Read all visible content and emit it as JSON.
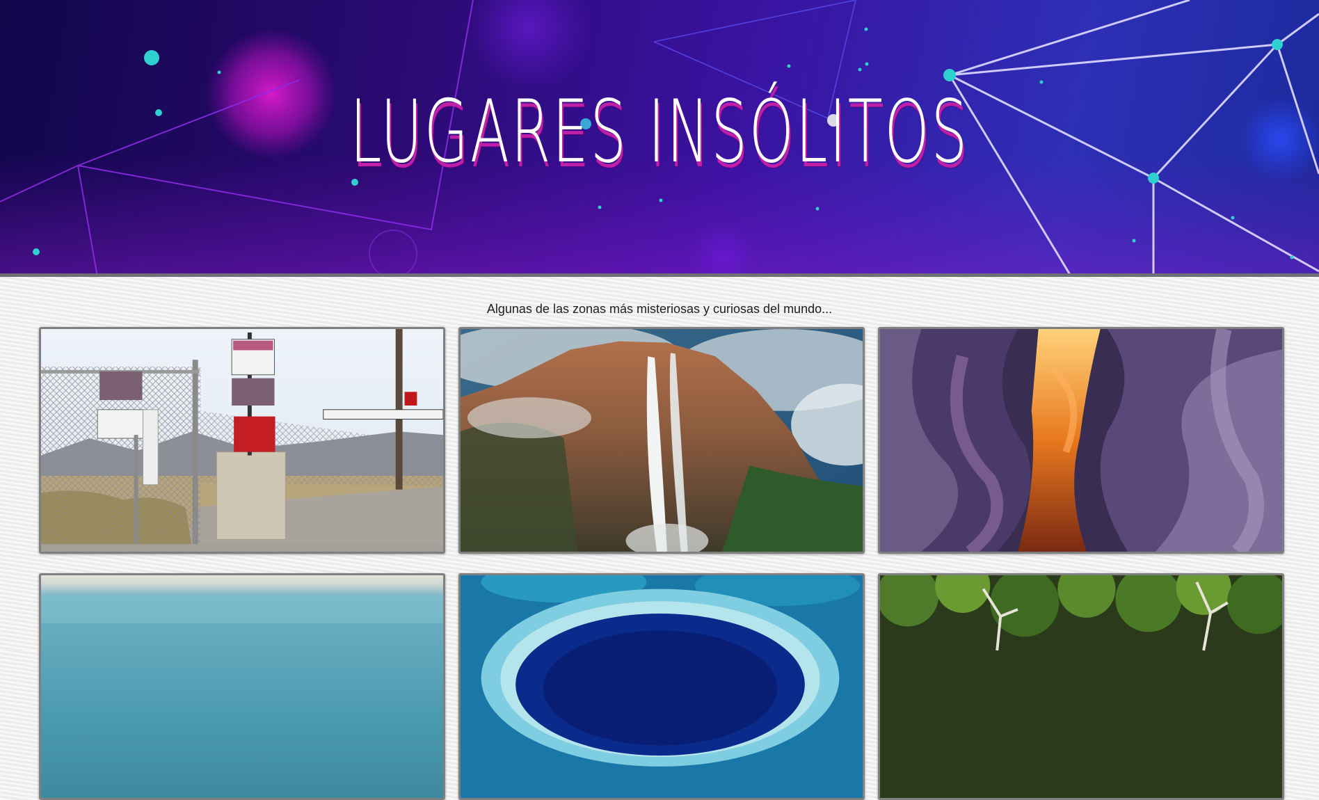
{
  "header": {
    "title": "LUGARES INSÓLITOS",
    "background_colors": [
      "#10064a",
      "#3a12a0",
      "#2d2fb5"
    ],
    "title_shadow_color": "#c01fa8"
  },
  "intro": {
    "tagline": "Algunas de las zonas más misteriosas y curiosas del mundo..."
  },
  "gallery": {
    "cards": [
      {
        "subject": "restricted area fence with warning signs",
        "signs": [
          "WARNING!",
          "WARNING",
          "WARNING",
          "WARNING!",
          "PHOTOGRAPHY OF THIS AREA IS PROHIBITED"
        ]
      },
      {
        "subject": "tall waterfall on a cliff"
      },
      {
        "subject": "slot canyon with orange and purple walls"
      },
      {
        "subject": "calm turquoise water"
      },
      {
        "subject": "blue hole in a reef"
      },
      {
        "subject": "dense green forest"
      }
    ]
  }
}
